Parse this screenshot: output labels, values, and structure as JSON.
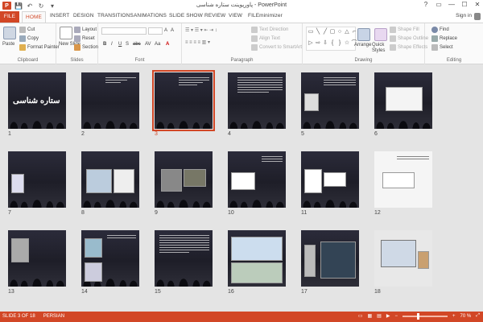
{
  "window": {
    "title": "پاورپوینت ستاره شناسی - PowerPoint",
    "controls": [
      "?",
      "▭",
      "—",
      "☐",
      "✕"
    ]
  },
  "qat": {
    "save": "💾",
    "undo": "↶",
    "redo": "↻",
    "more": "▾"
  },
  "tabs": [
    "FILE",
    "HOME",
    "INSERT",
    "DESIGN",
    "TRANSITIONS",
    "ANIMATIONS",
    "SLIDE SHOW",
    "REVIEW",
    "VIEW",
    "FILEminimizer"
  ],
  "signin": "Sign in",
  "ribbon": {
    "clipboard": {
      "paste": "Paste",
      "cut": "Cut",
      "copy": "Copy",
      "format_painter": "Format Painter",
      "label": "Clipboard"
    },
    "slides": {
      "new_slide": "New Slide",
      "layout": "Layout",
      "reset": "Reset",
      "section": "Section",
      "label": "Slides"
    },
    "font": {
      "label": "Font",
      "buttons": [
        "B",
        "I",
        "U",
        "S",
        "abc",
        "AV",
        "Aa",
        "A"
      ]
    },
    "paragraph": {
      "text_direction": "Text Direction",
      "align_text": "Align Text",
      "convert_smartart": "Convert to SmartArt",
      "label": "Paragraph"
    },
    "drawing": {
      "arrange": "Arrange",
      "quick_styles": "Quick Styles",
      "shape_fill": "Shape Fill",
      "shape_outline": "Shape Outline",
      "shape_effects": "Shape Effects",
      "label": "Drawing"
    },
    "editing": {
      "find": "Find",
      "replace": "Replace",
      "select": "Select",
      "label": "Editing"
    }
  },
  "slides": {
    "selected": 3,
    "numbers": [
      "1",
      "2",
      "3",
      "4",
      "5",
      "6",
      "7",
      "8",
      "9",
      "10",
      "11",
      "12",
      "13",
      "14",
      "15",
      "16",
      "17",
      "18"
    ],
    "slide1_title": "ستاره شناسی"
  },
  "status": {
    "slide_of": "SLIDE 3 OF 18",
    "language": "PERSIAN",
    "zoom": "70 %",
    "zoom_value": 70
  },
  "colors": {
    "accent": "#d24726",
    "ribbon_bg": "#fafafa",
    "slide_bg": "#20202a"
  }
}
